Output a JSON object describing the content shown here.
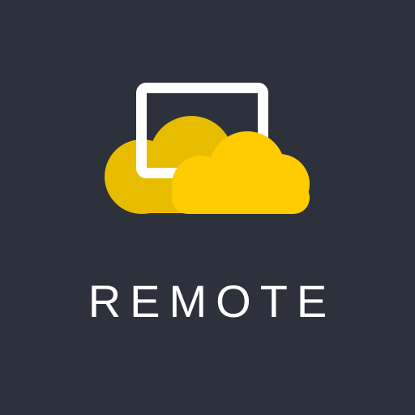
{
  "app": {
    "name": "REMOTE"
  },
  "logo": {
    "icon_name": "cloud-screen-icon",
    "cloud_color_front": "#ffcc00",
    "cloud_color_back": "#e8bd00",
    "screen_frame_color": "#ffffff"
  },
  "colors": {
    "background": "#2d313b",
    "text": "#ffffff"
  }
}
